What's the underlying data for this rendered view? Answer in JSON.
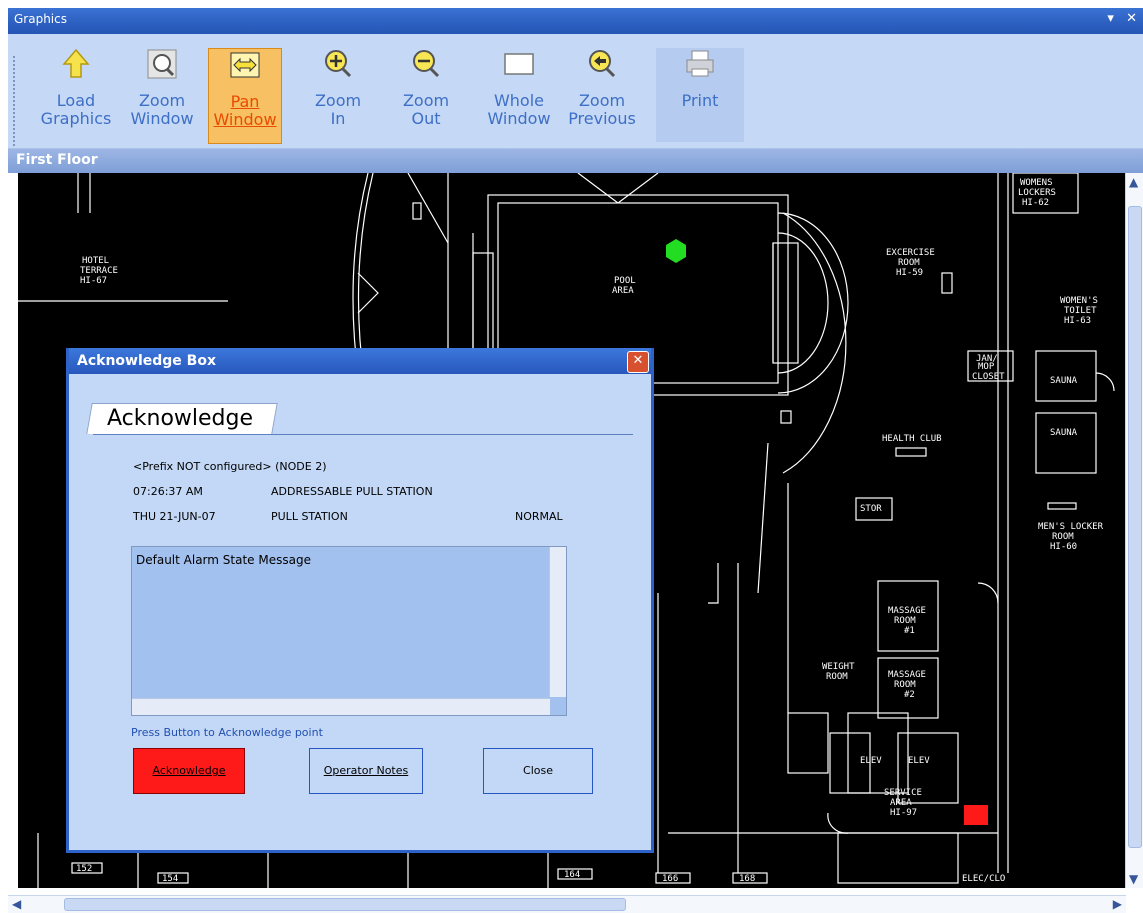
{
  "window": {
    "title": "Graphics",
    "pin_icon": "▾",
    "close_icon": "✕"
  },
  "toolbar": {
    "buttons": [
      {
        "line1": "Load",
        "line2": "Graphics",
        "icon": "up-arrow-icon"
      },
      {
        "line1": "Zoom",
        "line2": "Window",
        "icon": "zoom-window-icon"
      },
      {
        "line1": "Pan",
        "line2": "Window",
        "icon": "pan-arrows-icon",
        "active": true
      },
      {
        "line1": "Zoom",
        "line2": "In",
        "icon": "zoom-in-icon"
      },
      {
        "line1": "Zoom",
        "line2": "Out",
        "icon": "zoom-out-icon"
      },
      {
        "line1": "Whole",
        "line2": "Window",
        "icon": "whole-window-icon"
      },
      {
        "line1": "Zoom",
        "line2": "Previous",
        "icon": "zoom-previous-icon"
      },
      {
        "line1": "Print",
        "line2": "",
        "icon": "printer-icon"
      }
    ]
  },
  "floor": {
    "title": "First Floor"
  },
  "map": {
    "rooms": [
      "HOTEL",
      "TERRACE",
      "HI-67",
      "POOL",
      "AREA",
      "EXCERCISE",
      "ROOM",
      "HI-59",
      "WOMENS",
      "LOCKERS",
      "HI-62",
      "WOMEN'S",
      "TOILET",
      "HI-63",
      "JAN/",
      "MOP",
      "CLOSET",
      "SAUNA",
      "SAUNA",
      "HEALTH CLUB",
      "STOR",
      "MEN'S LOCKER",
      "ROOM",
      "HI-60",
      "MASSAGE",
      "ROOM",
      "#1",
      "WEIGHT",
      "ROOM",
      "MASSAGE",
      "ROOM",
      "#2",
      "ELEV",
      "ELEV",
      "SERVICE",
      "AREA",
      "HI-97",
      "ELEC/CLO",
      "154",
      "152",
      "164",
      "166",
      "168"
    ],
    "colors": {
      "background": "#000000",
      "lines": "#ffffff",
      "normal_device": "#22dd22",
      "alarm_device": "#ff1a1a"
    }
  },
  "dialog": {
    "title": "Acknowledge Box",
    "close_icon": "✕",
    "tab_label": "Acknowledge",
    "prefix_line": "<Prefix NOT configured> (NODE 2)",
    "time": "07:26:37 AM",
    "device_name": "ADDRESSABLE PULL STATION",
    "date": "THU 21-JUN-07",
    "device_type": "PULL STATION",
    "status": "NORMAL",
    "message": "Default Alarm State Message",
    "hint": "Press Button to Acknowledge point",
    "buttons": {
      "acknowledge": "Acknowledge",
      "operator_notes": "Operator Notes",
      "close": "Close"
    }
  },
  "scrollbars": {
    "up": "▲",
    "down": "▼",
    "left": "◀",
    "right": "▶"
  }
}
